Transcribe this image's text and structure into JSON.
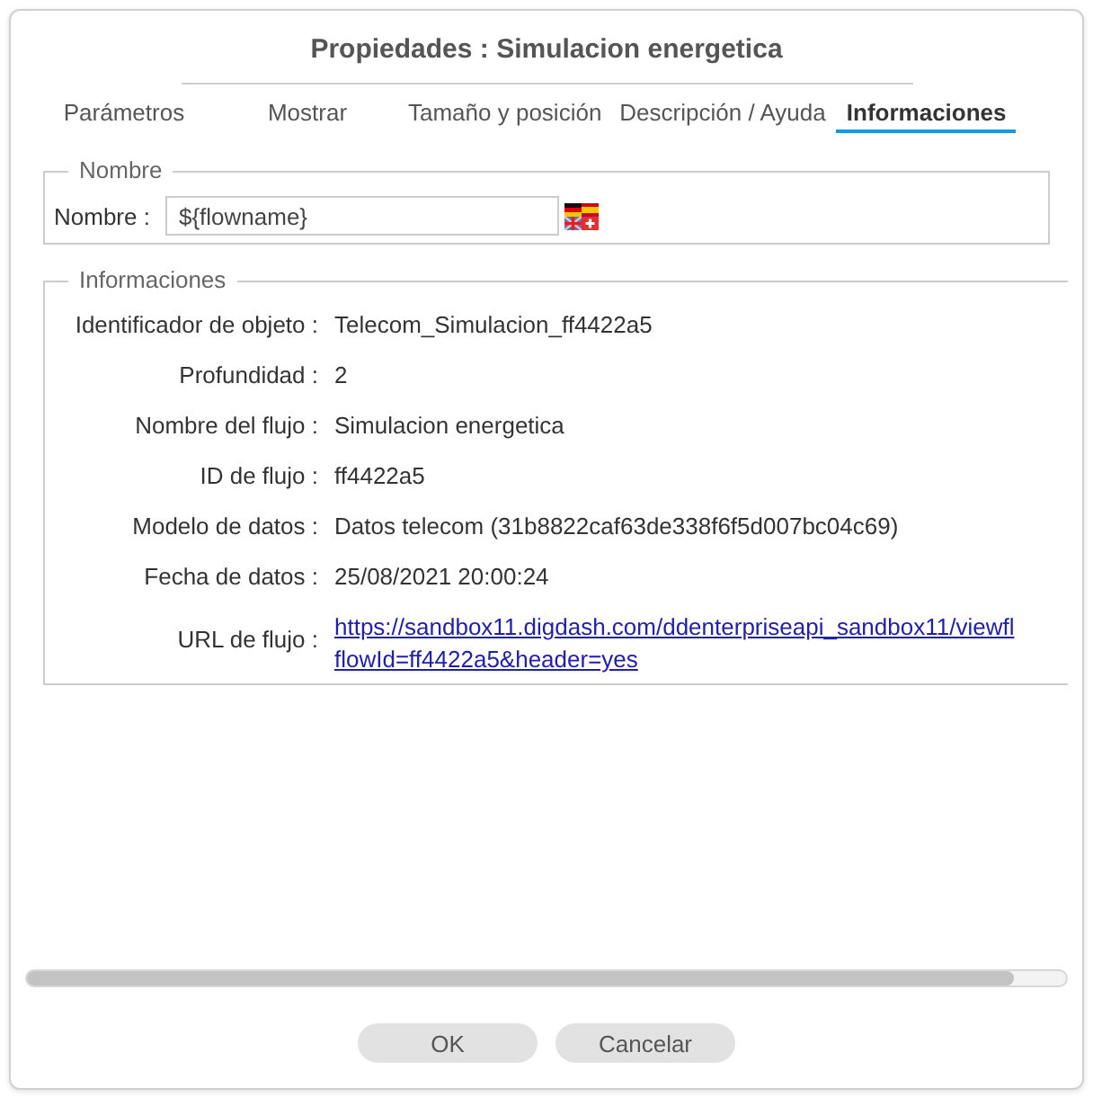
{
  "dialog": {
    "title": "Propiedades : Simulacion energetica"
  },
  "tabs": [
    {
      "label": "Parámetros",
      "selected": false
    },
    {
      "label": "Mostrar",
      "selected": false
    },
    {
      "label": "Tamaño y posición",
      "selected": false
    },
    {
      "label": "Descripción / Ayuda",
      "selected": false
    },
    {
      "label": "Informaciones",
      "selected": true
    }
  ],
  "name_group": {
    "legend": "Nombre",
    "label": "Nombre :",
    "value": "${flowname}"
  },
  "info_group": {
    "legend": "Informaciones",
    "rows": [
      {
        "kind": "text",
        "label": "Identificador de objeto :",
        "value": "Telecom_Simulacion_ff4422a5"
      },
      {
        "kind": "text",
        "label": "Profundidad :",
        "value": "2"
      },
      {
        "kind": "text",
        "label": "Nombre del flujo :",
        "value": "Simulacion energetica"
      },
      {
        "kind": "text",
        "label": "ID de flujo :",
        "value": "ff4422a5"
      },
      {
        "kind": "text",
        "label": "Modelo de datos :",
        "value": "Datos telecom (31b8822caf63de338f6f5d007bc04c69)"
      },
      {
        "kind": "text",
        "label": "Fecha de datos :",
        "value": "25/08/2021 20:00:24"
      },
      {
        "kind": "link",
        "label": "URL de flujo :",
        "value_lines": [
          "https://sandbox11.digdash.com/ddenterpriseapi_sandbox11/viewfl",
          "flowId=ff4422a5&header=yes"
        ]
      }
    ]
  },
  "buttons": [
    {
      "label": "OK"
    },
    {
      "label": "Cancelar"
    }
  ]
}
